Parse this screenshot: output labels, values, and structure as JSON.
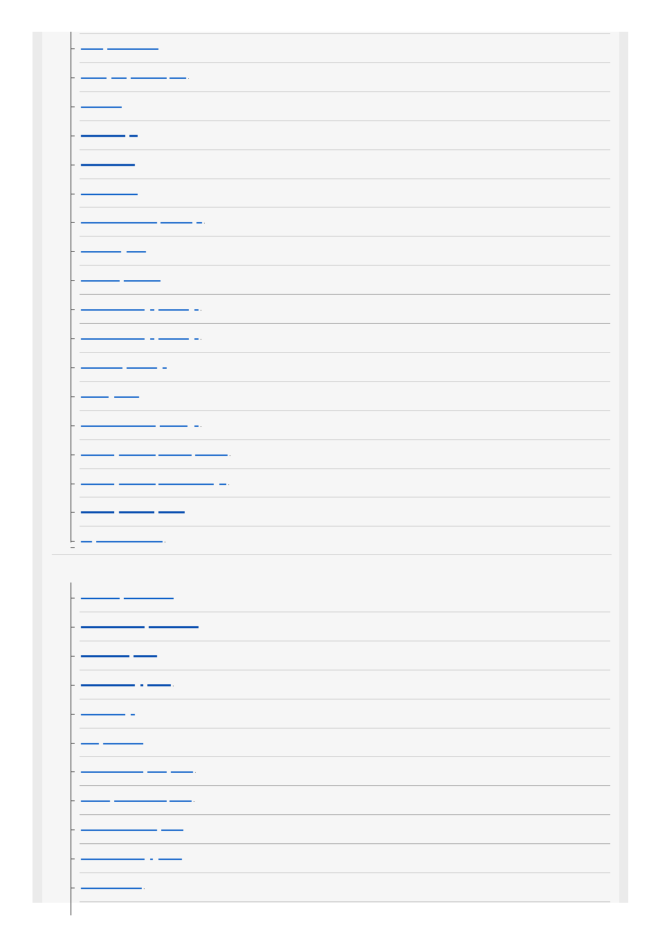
{
  "colors": {
    "frame": "#ebebeb",
    "panel": "#f6f6f6",
    "link": "#0b5fc8",
    "separator": "#cccccc",
    "tree_line": "#444444"
  },
  "sections": [
    {
      "name": "section-1",
      "items": [
        {
          "segments": [
            [
              0,
              32
            ],
            [
              38,
              112
            ]
          ],
          "trailing_dot": false,
          "bold": false,
          "dark_sep": false,
          "last": false
        },
        {
          "segments": [
            [
              0,
              37
            ],
            [
              44,
              66
            ],
            [
              72,
              124
            ],
            [
              128,
              152
            ]
          ],
          "trailing_dot": true,
          "bold": false,
          "dark_sep": false,
          "last": false
        },
        {
          "segments": [
            [
              0,
              59
            ]
          ],
          "trailing_dot": false,
          "bold": false,
          "dark_sep": false,
          "last": false
        },
        {
          "segments": [
            [
              0,
              64
            ],
            [
              70,
              82
            ]
          ],
          "trailing_dot": false,
          "bold": true,
          "dark_sep": false,
          "last": false
        },
        {
          "segments": [
            [
              0,
              78
            ]
          ],
          "trailing_dot": false,
          "bold": true,
          "dark_sep": false,
          "last": false
        },
        {
          "segments": [
            [
              0,
              82
            ]
          ],
          "trailing_dot": false,
          "bold": false,
          "dark_sep": false,
          "last": false
        },
        {
          "segments": [
            [
              0,
              110
            ],
            [
              115,
              161
            ],
            [
              167,
              175
            ]
          ],
          "trailing_dot": true,
          "bold": false,
          "dark_sep": false,
          "last": false
        },
        {
          "segments": [
            [
              0,
              58
            ],
            [
              66,
              94
            ]
          ],
          "trailing_dot": false,
          "bold": false,
          "dark_sep": false,
          "last": false
        },
        {
          "segments": [
            [
              0,
              56
            ],
            [
              62,
              115
            ]
          ],
          "trailing_dot": false,
          "bold": false,
          "dark_sep": false,
          "last": false
        },
        {
          "segments": [
            [
              0,
              92
            ],
            [
              100,
              106
            ],
            [
              112,
              156
            ],
            [
              164,
              170
            ]
          ],
          "trailing_dot": true,
          "bold": false,
          "dark_sep": true,
          "last": false
        },
        {
          "segments": [
            [
              0,
              92
            ],
            [
              100,
              106
            ],
            [
              112,
              156
            ],
            [
              164,
              170
            ]
          ],
          "trailing_dot": true,
          "bold": false,
          "dark_sep": true,
          "last": false
        },
        {
          "segments": [
            [
              0,
              60
            ],
            [
              66,
              110
            ],
            [
              118,
              124
            ]
          ],
          "trailing_dot": false,
          "bold": false,
          "dark_sep": false,
          "last": false
        },
        {
          "segments": [
            [
              0,
              40
            ],
            [
              48,
              84
            ]
          ],
          "trailing_dot": false,
          "bold": false,
          "dark_sep": false,
          "last": false
        },
        {
          "segments": [
            [
              0,
              108
            ],
            [
              114,
              154
            ],
            [
              164,
              170
            ]
          ],
          "trailing_dot": true,
          "bold": false,
          "dark_sep": false,
          "last": false
        },
        {
          "segments": [
            [
              0,
              48
            ],
            [
              55,
              108
            ],
            [
              112,
              160
            ],
            [
              165,
              212
            ]
          ],
          "trailing_dot": true,
          "bold": false,
          "dark_sep": false,
          "last": false
        },
        {
          "segments": [
            [
              0,
              48
            ],
            [
              55,
              108
            ],
            [
              112,
              192
            ],
            [
              200,
              210
            ]
          ],
          "trailing_dot": true,
          "bold": false,
          "dark_sep": false,
          "last": false
        },
        {
          "segments": [
            [
              0,
              48
            ],
            [
              55,
              106
            ],
            [
              112,
              150
            ]
          ],
          "trailing_dot": false,
          "bold": true,
          "dark_sep": false,
          "last": false
        },
        {
          "segments": [
            [
              0,
              16
            ],
            [
              22,
              118
            ]
          ],
          "trailing_dot": true,
          "bold": false,
          "dark_sep": false,
          "last": true
        }
      ]
    },
    {
      "name": "section-2",
      "items": [
        {
          "segments": [
            [
              0,
              56
            ],
            [
              62,
              134
            ]
          ],
          "trailing_dot": false,
          "bold": false,
          "dark_sep": false,
          "last": false
        },
        {
          "segments": [
            [
              0,
              92
            ],
            [
              98,
              170
            ]
          ],
          "trailing_dot": false,
          "bold": true,
          "dark_sep": false,
          "last": false
        },
        {
          "segments": [
            [
              0,
              70
            ],
            [
              76,
              110
            ]
          ],
          "trailing_dot": false,
          "bold": true,
          "dark_sep": false,
          "last": false
        },
        {
          "segments": [
            [
              0,
              78
            ],
            [
              86,
              90
            ],
            [
              96,
              130
            ]
          ],
          "trailing_dot": true,
          "bold": true,
          "dark_sep": false,
          "last": false
        },
        {
          "segments": [
            [
              0,
              64
            ],
            [
              72,
              78
            ]
          ],
          "trailing_dot": false,
          "bold": false,
          "dark_sep": false,
          "last": false
        },
        {
          "segments": [
            [
              0,
              26
            ],
            [
              32,
              90
            ]
          ],
          "trailing_dot": false,
          "bold": false,
          "dark_sep": false,
          "last": false
        },
        {
          "segments": [
            [
              0,
              90
            ],
            [
              96,
              124
            ],
            [
              130,
              162
            ]
          ],
          "trailing_dot": true,
          "bold": false,
          "dark_sep": false,
          "last": false
        },
        {
          "segments": [
            [
              0,
              42
            ],
            [
              48,
              124
            ],
            [
              128,
              160
            ]
          ],
          "trailing_dot": true,
          "bold": false,
          "dark_sep": true,
          "last": false
        },
        {
          "segments": [
            [
              0,
              110
            ],
            [
              116,
              148
            ]
          ],
          "trailing_dot": false,
          "bold": false,
          "dark_sep": true,
          "last": false
        },
        {
          "segments": [
            [
              0,
              92
            ],
            [
              100,
              104
            ],
            [
              112,
              146
            ]
          ],
          "trailing_dot": false,
          "bold": false,
          "dark_sep": true,
          "last": false
        },
        {
          "segments": [
            [
              0,
              88
            ]
          ],
          "trailing_dot": true,
          "bold": false,
          "dark_sep": false,
          "last": false
        }
      ]
    }
  ]
}
